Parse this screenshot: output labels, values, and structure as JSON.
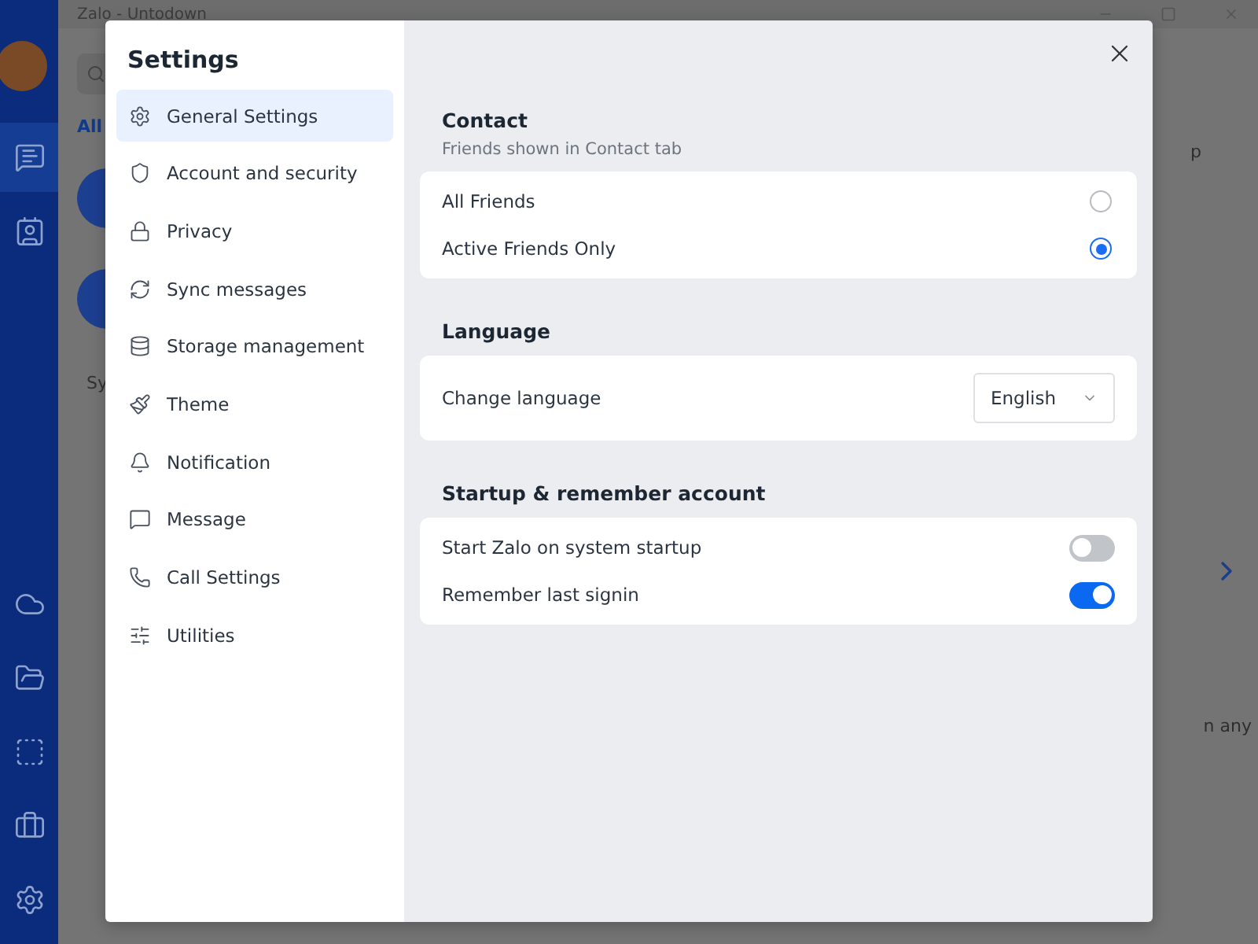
{
  "app_window": {
    "title": "Zalo - Untodown",
    "tab": "All",
    "list_text": "Sy",
    "side_text_top": "p",
    "side_text_bottom": "n any"
  },
  "rail_items": [
    {
      "selected": true
    },
    {
      "selected": false
    },
    {
      "selected": false
    },
    {
      "selected": false
    },
    {
      "selected": false
    },
    {
      "selected": false
    },
    {
      "selected": false
    }
  ],
  "settings": {
    "title": "Settings",
    "menu": [
      {
        "label": "General Settings",
        "selected": true
      },
      {
        "label": "Account and security",
        "selected": false
      },
      {
        "label": "Privacy",
        "selected": false
      },
      {
        "label": "Sync messages",
        "selected": false
      },
      {
        "label": "Storage management",
        "selected": false
      },
      {
        "label": "Theme",
        "selected": false
      },
      {
        "label": "Notification",
        "selected": false
      },
      {
        "label": "Message",
        "selected": false
      },
      {
        "label": "Call Settings",
        "selected": false
      },
      {
        "label": "Utilities",
        "selected": false
      }
    ],
    "sections": [
      {
        "kind": "radio",
        "title": "Contact",
        "subtitle": "Friends shown in Contact tab",
        "options": [
          {
            "label": "All Friends",
            "selected": false
          },
          {
            "label": "Active Friends Only",
            "selected": true
          }
        ]
      },
      {
        "kind": "select",
        "title": "Language",
        "label": "Change language",
        "value": "English"
      },
      {
        "kind": "toggles",
        "title": "Startup & remember account",
        "items": [
          {
            "label": "Start Zalo on system startup",
            "on": false
          },
          {
            "label": "Remember last signin",
            "on": true
          }
        ]
      }
    ]
  }
}
